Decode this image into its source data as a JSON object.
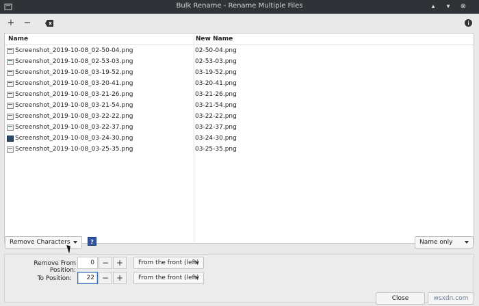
{
  "window": {
    "title": "Bulk Rename - Rename Multiple Files"
  },
  "toolbar": {
    "add_icon": "plus-icon",
    "remove_icon": "minus-icon",
    "clear_icon": "clear-backspace-icon",
    "info_icon": "info-icon"
  },
  "table": {
    "headers": {
      "name": "Name",
      "new_name": "New Name"
    },
    "rows": [
      {
        "name": "Screenshot_2019-10-08_02-50-04.png",
        "new_name": "02-50-04.png",
        "icon": "file-icon"
      },
      {
        "name": "Screenshot_2019-10-08_02-53-03.png",
        "new_name": "02-53-03.png",
        "icon": "file-icon"
      },
      {
        "name": "Screenshot_2019-10-08_03-19-52.png",
        "new_name": "03-19-52.png",
        "icon": "file-icon"
      },
      {
        "name": "Screenshot_2019-10-08_03-20-41.png",
        "new_name": "03-20-41.png",
        "icon": "file-icon"
      },
      {
        "name": "Screenshot_2019-10-08_03-21-26.png",
        "new_name": "03-21-26.png",
        "icon": "file-icon"
      },
      {
        "name": "Screenshot_2019-10-08_03-21-54.png",
        "new_name": "03-21-54.png",
        "icon": "file-icon"
      },
      {
        "name": "Screenshot_2019-10-08_03-22-22.png",
        "new_name": "03-22-22.png",
        "icon": "file-icon"
      },
      {
        "name": "Screenshot_2019-10-08_03-22-37.png",
        "new_name": "03-22-37.png",
        "icon": "file-icon"
      },
      {
        "name": "Screenshot_2019-10-08_03-24-30.png",
        "new_name": "03-24-30.png",
        "icon": "image-thumbnail-icon"
      },
      {
        "name": "Screenshot_2019-10-08_03-25-35.png",
        "new_name": "03-25-35.png",
        "icon": "file-icon"
      }
    ]
  },
  "controls": {
    "mode": "Remove Characters",
    "help": "?",
    "scope": "Name only"
  },
  "panel": {
    "remove_from_label": "Remove From Position:",
    "remove_from_value": "0",
    "remove_from_direction": "From the front (left)",
    "to_label": "To Position:",
    "to_value": "22",
    "to_direction": "From the front (left)",
    "minus": "−",
    "plus": "+"
  },
  "footer": {
    "close": "Close",
    "rename_partial": "wsxdn.com"
  }
}
